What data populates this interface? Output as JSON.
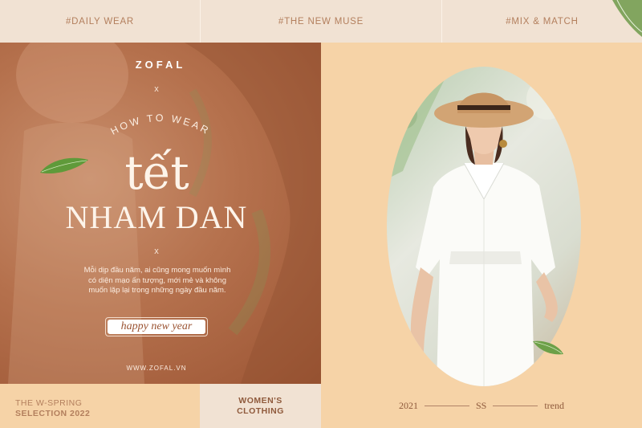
{
  "topbar": {
    "tag1": "#DAILY WEAR",
    "tag2": "#THE NEW MUSE",
    "tag3": "#MIX & MATCH"
  },
  "panel": {
    "brand": "ZOFAL",
    "separator": "x",
    "arc_text": "HOW TO WEAR",
    "script_title": "tết",
    "headline": "NHAM DAN",
    "description": "Mỗi dịp đầu năm, ai cũng mong muốn mình có diện mạo ấn tượng, mới mẻ và không muốn lặp lại trong những ngày đầu năm.",
    "cta": "happy new year",
    "website": "WWW.ZOFAL.VN"
  },
  "footer": {
    "line1": "THE W-SPRING",
    "line2": "SELECTION 2022",
    "category_line1": "WOMEN'S",
    "category_line2": "CLOTHING",
    "trend_year": "2021",
    "trend_season": "SS",
    "trend_word": "trend"
  },
  "colors": {
    "panel_brown": "#b5714d",
    "peach": "#f6d3a7",
    "cream": "#f1e2d3",
    "text_brown": "#b37f5d"
  }
}
